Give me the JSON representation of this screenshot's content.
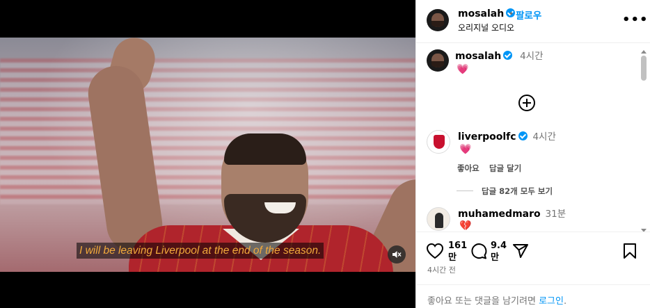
{
  "video": {
    "subtitle": "I will be leaving Liverpool at the end of the season.",
    "mute_icon": "speaker-muted-icon"
  },
  "header": {
    "username": "mosalah",
    "separator": "•",
    "follow_label": "팔로우",
    "audio_label": "오리지널 오디오",
    "more_icon": "more-horizontal-icon"
  },
  "comments": [
    {
      "username": "mosalah",
      "time": "4시간",
      "text": "💗"
    },
    {
      "username": "liverpoolfc",
      "time": "4시간",
      "text": "💗",
      "like_label": "좋아요",
      "reply_label": "답글 달기",
      "view_replies": "답글 82개 모두 보기"
    },
    {
      "username": "muhamedmaro",
      "time": "31분",
      "text": "💔"
    }
  ],
  "load_more_icon": "plus-circle-icon",
  "actions": {
    "likes_count_line1": "161",
    "likes_count_line2": "만",
    "comments_count_line1": "9.4",
    "comments_count_line2": "만",
    "posted_time": "4시간 전",
    "login_prompt": "좋아요 또는 댓글을 남기려면 ",
    "login_link": "로그인",
    "login_suffix": "."
  },
  "colors": {
    "accent": "#0095f6",
    "subtitle": "#f2a93b",
    "heart": "#ff3d6e",
    "secondary_text": "#737373"
  }
}
